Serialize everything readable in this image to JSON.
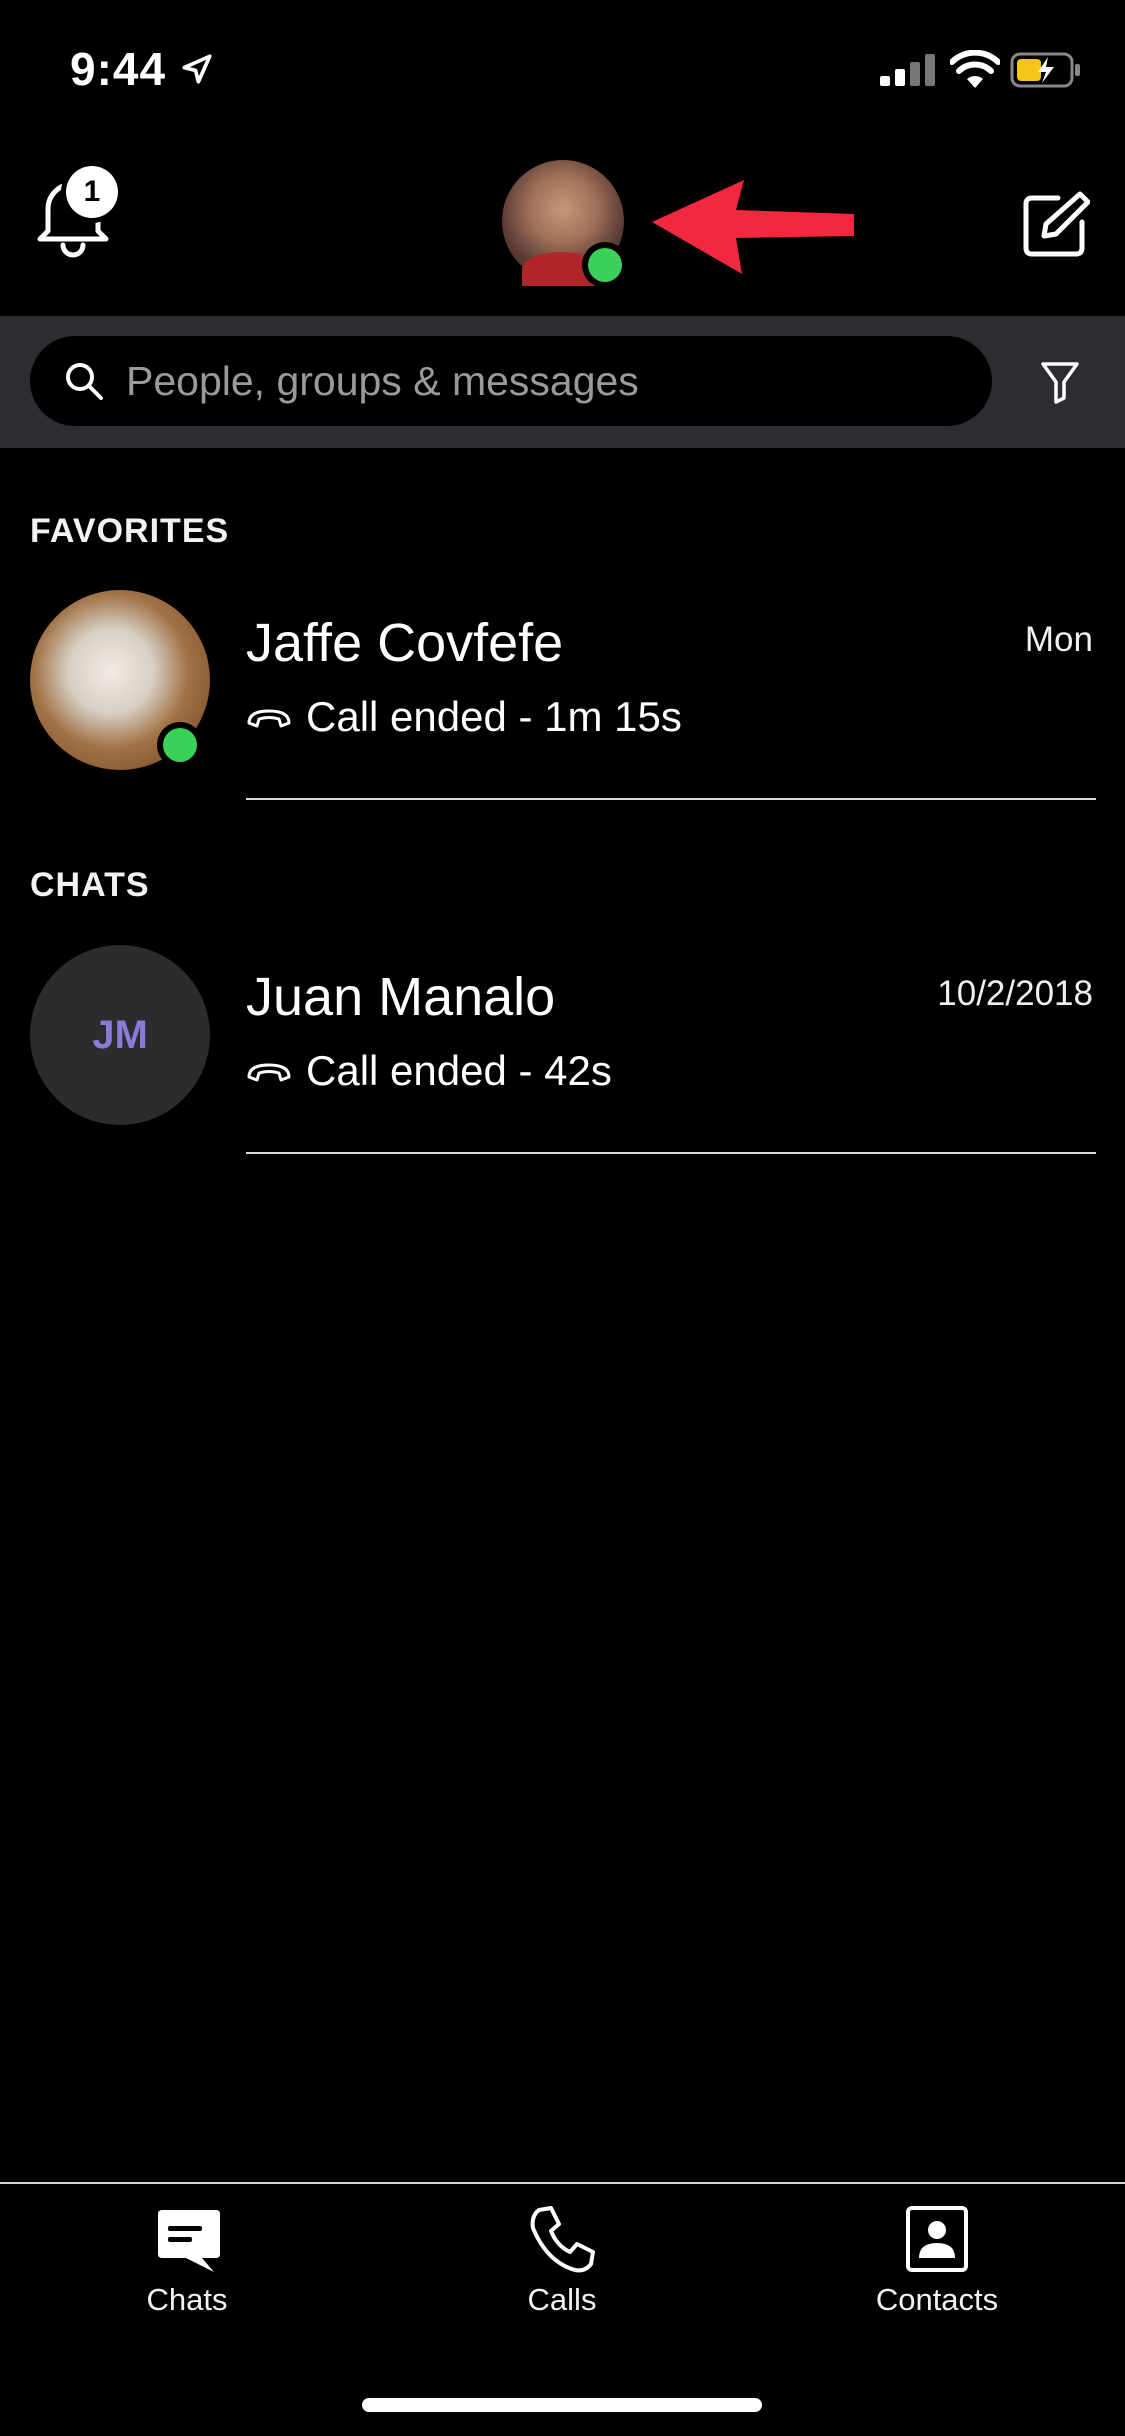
{
  "status_bar": {
    "time": "9:44"
  },
  "header": {
    "notification_count": "1"
  },
  "search": {
    "placeholder": "People, groups & messages"
  },
  "favorites": {
    "title": "FAVORITES",
    "items": [
      {
        "name": "Jaffe Covfefe",
        "status": "Call ended - 1m 15s",
        "date": "Mon",
        "online": true
      }
    ]
  },
  "chats": {
    "title": "CHATS",
    "items": [
      {
        "initials": "JM",
        "name": "Juan Manalo",
        "status": "Call ended - 42s",
        "date": "10/2/2018"
      }
    ]
  },
  "tabs": [
    {
      "label": "Chats",
      "icon": "chat-bubble-icon"
    },
    {
      "label": "Calls",
      "icon": "phone-icon"
    },
    {
      "label": "Contacts",
      "icon": "contact-card-icon"
    }
  ],
  "colors": {
    "presence": "#3ad15a",
    "arrow": "#f1283e",
    "initials": "#8a7bd6",
    "search_band": "#2b2d30"
  }
}
